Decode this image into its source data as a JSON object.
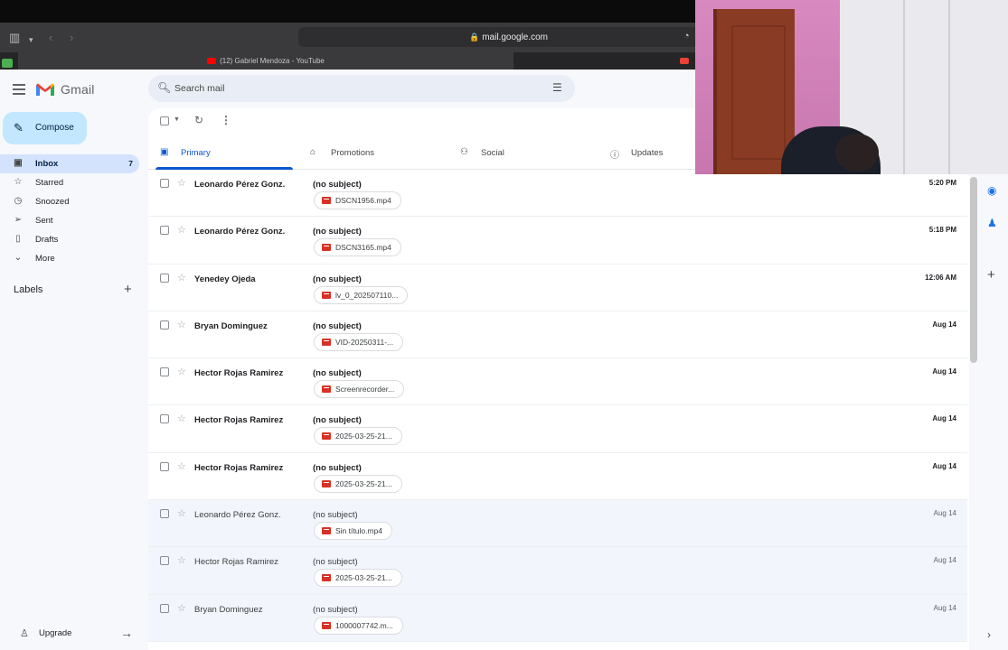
{
  "browser": {
    "url": "mail.google.com",
    "tabs": [
      {
        "title": "(12) Gabriel Mendoza - YouTube",
        "favicon_color": "#ff0000"
      }
    ]
  },
  "gmail": {
    "app_name": "Gmail",
    "search_placeholder": "Search mail",
    "compose_label": "Compose",
    "nav": [
      {
        "label": "Inbox",
        "count": "7",
        "icon": "inbox-icon"
      },
      {
        "label": "Starred",
        "count": "",
        "icon": "star-icon"
      },
      {
        "label": "Snoozed",
        "count": "",
        "icon": "clock-icon"
      },
      {
        "label": "Sent",
        "count": "",
        "icon": "send-icon"
      },
      {
        "label": "Drafts",
        "count": "",
        "icon": "draft-icon"
      },
      {
        "label": "More",
        "count": "",
        "icon": "chevron-down-icon"
      }
    ],
    "labels_header": "Labels",
    "upgrade_label": "Upgrade",
    "categories": [
      {
        "label": "Primary",
        "icon": "inbox-icon",
        "active": true
      },
      {
        "label": "Promotions",
        "icon": "tag-icon",
        "active": false
      },
      {
        "label": "Social",
        "icon": "people-icon",
        "active": false
      },
      {
        "label": "Updates",
        "icon": "info-icon",
        "active": false
      }
    ],
    "emails": [
      {
        "sender": "Leonardo Pérez Gonz.",
        "subject": "(no subject)",
        "attachment": "DSCN1956.mp4",
        "time": "5:20 PM",
        "unread": true
      },
      {
        "sender": "Leonardo Pérez Gonz.",
        "subject": "(no subject)",
        "attachment": "DSCN3165.mp4",
        "time": "5:18 PM",
        "unread": true
      },
      {
        "sender": "Yenedey Ojeda",
        "subject": "(no subject)",
        "attachment": "lv_0_202507110...",
        "time": "12:06 AM",
        "unread": true
      },
      {
        "sender": "Bryan Dominguez",
        "subject": "(no subject)",
        "attachment": "VID-20250311-...",
        "time": "Aug 14",
        "unread": true
      },
      {
        "sender": "Hector Rojas Ramirez",
        "subject": "(no subject)",
        "attachment": "Screenrecorder...",
        "time": "Aug 14",
        "unread": true
      },
      {
        "sender": "Hector Rojas Ramirez",
        "subject": "(no subject)",
        "attachment": "2025-03-25-21...",
        "time": "Aug 14",
        "unread": true
      },
      {
        "sender": "Hector Rojas Ramirez",
        "subject": "(no subject)",
        "attachment": "2025-03-25-21...",
        "time": "Aug 14",
        "unread": true
      },
      {
        "sender": "Leonardo Pérez Gonz.",
        "subject": "(no subject)",
        "attachment": "Sin título.mp4",
        "time": "Aug 14",
        "unread": false
      },
      {
        "sender": "Hector Rojas Ramirez",
        "subject": "(no subject)",
        "attachment": "2025-03-25-21...",
        "time": "Aug 14",
        "unread": false
      },
      {
        "sender": "Bryan Dominguez",
        "subject": "(no subject)",
        "attachment": "1000007742.m...",
        "time": "Aug 14",
        "unread": false
      }
    ]
  },
  "colors": {
    "accent": "#0b57d0",
    "compose_bg": "#c2e7ff",
    "inbox_active": "#d3e3fd",
    "attachment_icon": "#d93025"
  }
}
